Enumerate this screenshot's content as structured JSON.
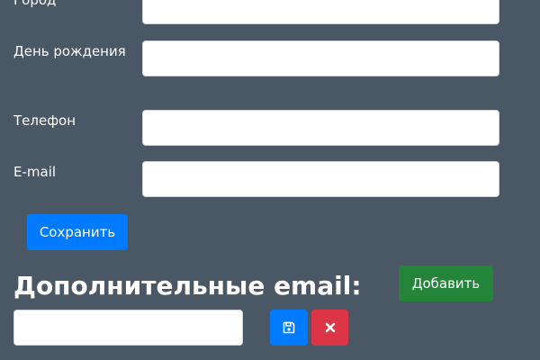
{
  "form": {
    "city_label": "Город",
    "birthday_label": "День рождения",
    "phone_label": "Телефон",
    "email_label": "E-mail",
    "city_value": "",
    "birthday_value": "",
    "phone_value": "",
    "email_value": "",
    "save_label": "Сохранить"
  },
  "additional_emails": {
    "heading": "Дополнительные email:",
    "add_label": "Добавить",
    "new_email_value": "",
    "save_icon": "floppy-disk-icon",
    "remove_icon": "close-icon"
  },
  "colors": {
    "background": "#4a5764",
    "primary": "#007bff",
    "success": "#23843a",
    "danger": "#dc3545"
  }
}
